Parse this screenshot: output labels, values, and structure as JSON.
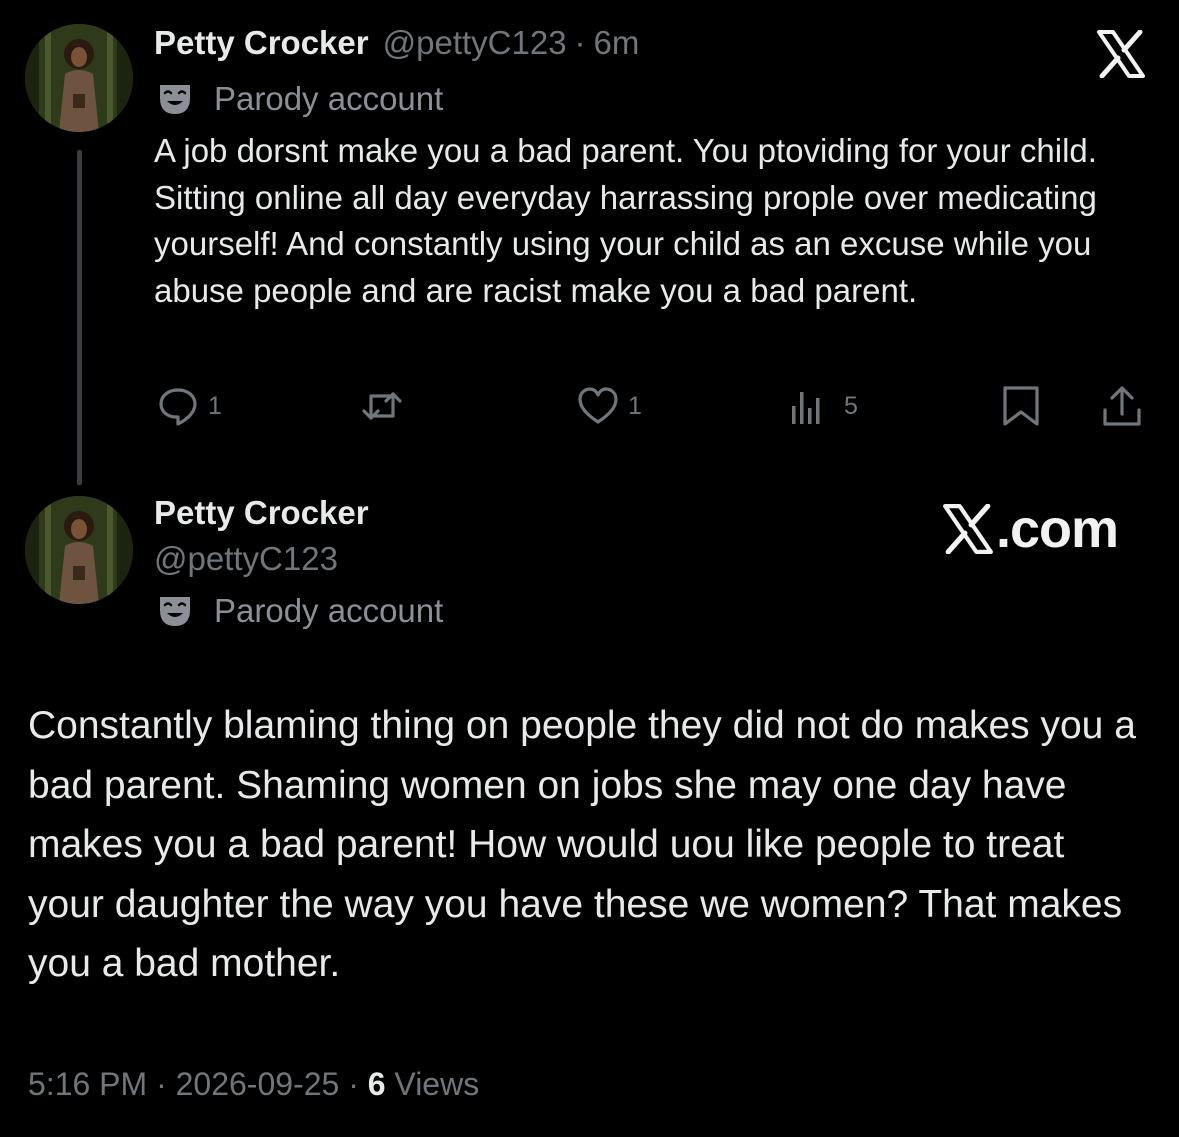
{
  "tweet1": {
    "author_name": "Petty Crocker",
    "handle": "@pettyC123",
    "separator": "·",
    "time": "6m",
    "label": "Parody account",
    "text": "A job dorsnt make you a bad parent. You ptoviding for your child. Sitting online all day everyday harrassing prople over medicating yourself! And constantly using your child as an excuse while you abuse people and are racist make you a bad parent.",
    "actions": {
      "reply_count": "1",
      "like_count": "1",
      "views_count": "5"
    }
  },
  "tweet2": {
    "author_name": "Petty Crocker",
    "handle": "@pettyC123",
    "label": "Parody account",
    "text": "Constantly blaming thing on people they did not do makes you a bad parent. Shaming women on jobs she may one day have makes you a bad parent! How would uou like people to treat your daughter the way you have these we women? That makes you a bad mother.",
    "time": "5:16 PM",
    "date": "2026-09-25",
    "views_count": "6",
    "views_label": "Views"
  },
  "branding": {
    "watermark_text": ".com",
    "icons": [
      "x-logo-icon",
      "x-com-logo"
    ]
  },
  "icons": [
    "drama-mask-icon",
    "reply-icon",
    "repost-icon",
    "like-icon",
    "views-icon",
    "bookmark-icon",
    "share-icon"
  ],
  "colors": {
    "background": "#000000",
    "primary_text": "#e7e9ea",
    "secondary_text": "#71767b",
    "thread_line": "#3a3d41"
  }
}
